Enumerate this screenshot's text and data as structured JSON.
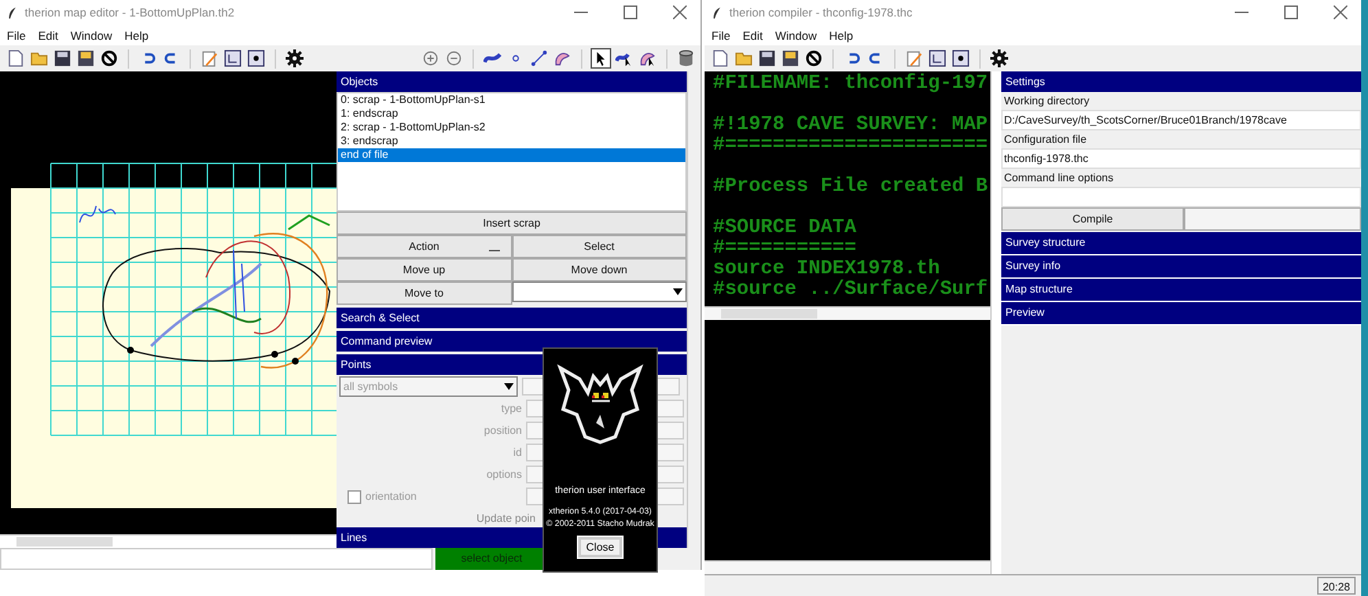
{
  "map_editor": {
    "title": "therion map editor - 1-BottomUpPlan.th2",
    "menu": [
      "File",
      "Edit",
      "Window",
      "Help"
    ],
    "objects": {
      "header": "Objects",
      "items": [
        {
          "text": "0: scrap - 1-BottomUpPlan-s1",
          "selected": false
        },
        {
          "text": "1: endscrap",
          "selected": false
        },
        {
          "text": "2: scrap - 1-BottomUpPlan-s2",
          "selected": false
        },
        {
          "text": "3: endscrap",
          "selected": false
        },
        {
          "text": "end of file",
          "selected": true
        }
      ]
    },
    "buttons": {
      "insert": "Insert scrap",
      "action": "Action",
      "select": "Select",
      "move_up": "Move up",
      "move_down": "Move down",
      "move_to": "Move to"
    },
    "sections": [
      "Search & Select",
      "Command preview",
      "Points"
    ],
    "points": {
      "disabled": true,
      "symbol_filter": "all symbols",
      "type_label": "type",
      "field_labels": [
        "position",
        "id",
        "options"
      ],
      "orientation": {
        "label": "orientation",
        "checked": false
      },
      "update_button": "Update poin"
    },
    "lines_header": "Lines",
    "status": "select object"
  },
  "compiler": {
    "title": "therion compiler - thconfig-1978.thc",
    "menu": [
      "File",
      "Edit",
      "Window",
      "Help"
    ],
    "code_blocks": [
      [
        "#FILENAME: thconfig-197"
      ],
      [
        "#!1978 CAVE SURVEY: MAP",
        "#======================"
      ],
      [
        "#Process File created B"
      ],
      [
        "#SOURCE DATA",
        "#===========",
        "source INDEX1978.th",
        "#source ../Surface/Surf"
      ]
    ],
    "settings": {
      "header": "Settings",
      "fields": [
        {
          "label": "Working directory",
          "value": "D:/CaveSurvey/th_ScotsCorner/Bruce01Branch/1978cave"
        },
        {
          "label": "Configuration file",
          "value": "thconfig-1978.thc"
        },
        {
          "label": "Command line options"
        }
      ],
      "compile_button": "Compile"
    },
    "sections": [
      "Survey structure",
      "Survey info",
      "Map structure",
      "Preview"
    ],
    "clock": "20:28"
  },
  "about_dialog": {
    "title": "therion user interface",
    "version": "xtherion 5.4.0 (2017-04-03)",
    "copyright": "© 2002-2011 Stacho Mudrak",
    "close_button": "Close"
  }
}
